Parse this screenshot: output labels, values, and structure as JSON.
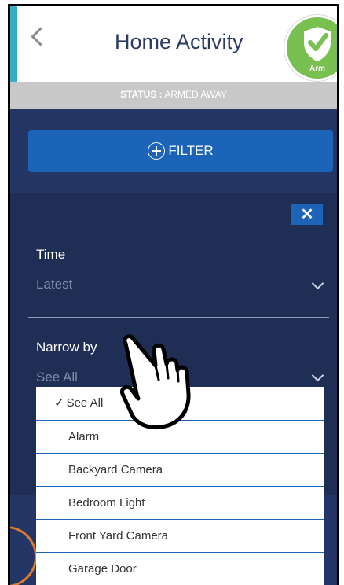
{
  "header": {
    "title": "Home Activity",
    "arm_label": "Arm"
  },
  "status": {
    "label": "STATUS :",
    "value": "ARMED AWAY"
  },
  "filter": {
    "button_label": "FILTER"
  },
  "panel": {
    "close_label": "✕",
    "time": {
      "label": "Time",
      "value": "Latest"
    },
    "narrow": {
      "label": "Narrow by",
      "value": "See All"
    }
  },
  "dropdown": {
    "options": [
      {
        "label": "See All",
        "selected": true
      },
      {
        "label": "Alarm"
      },
      {
        "label": "Backyard Camera"
      },
      {
        "label": "Bedroom Light"
      },
      {
        "label": "Front Yard Camera"
      },
      {
        "label": "Garage Door"
      }
    ]
  },
  "colors": {
    "accent": "#1c64b7",
    "panel": "#1f2e55",
    "arm_green": "#78c04f",
    "status_gray": "#c8c8c8"
  },
  "icons": [
    "back-chevron-icon",
    "shield-check-icon",
    "plus-circle-icon",
    "close-icon",
    "chevron-down-icon",
    "checkmark-icon",
    "pointing-hand-icon"
  ]
}
